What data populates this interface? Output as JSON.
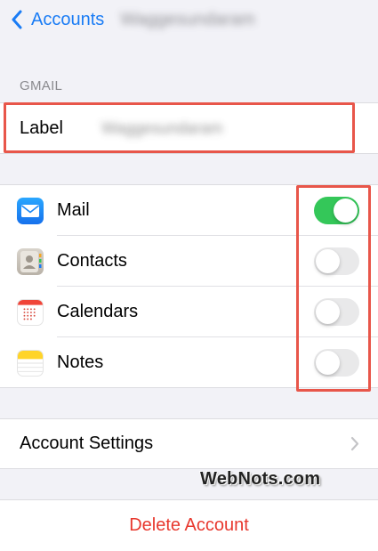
{
  "nav": {
    "back_label": "Accounts",
    "title": "Waggesundaram"
  },
  "section_header": "GMAIL",
  "label_row": {
    "title": "Label",
    "value": "Waggesundaram"
  },
  "services": [
    {
      "label": "Mail",
      "icon": "mail-icon",
      "enabled": true
    },
    {
      "label": "Contacts",
      "icon": "contacts-icon",
      "enabled": false
    },
    {
      "label": "Calendars",
      "icon": "calendar-icon",
      "enabled": false
    },
    {
      "label": "Notes",
      "icon": "notes-icon",
      "enabled": false
    }
  ],
  "account_settings": {
    "title": "Account Settings"
  },
  "delete_account": {
    "title": "Delete Account"
  },
  "watermark": "WebNots.com",
  "colors": {
    "accent": "#1a7cf5",
    "toggle_on": "#34c759",
    "toggle_off": "#e9e9ea",
    "destructive": "#e8382e",
    "highlight_box": "#e8564a"
  }
}
